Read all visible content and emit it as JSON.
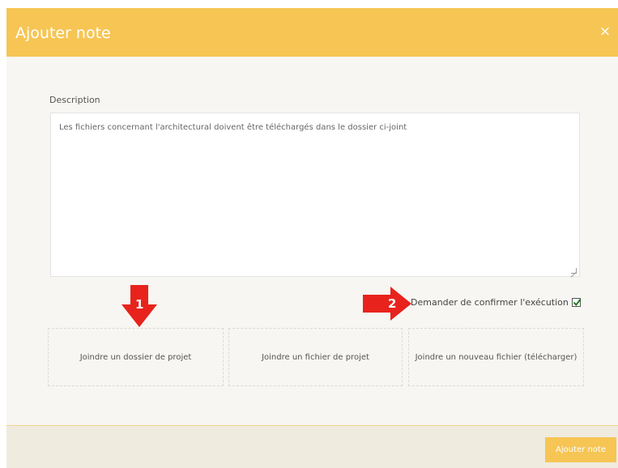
{
  "dialog": {
    "title": "Ajouter note",
    "close_glyph": "×"
  },
  "description": {
    "label": "Description",
    "value": "Les fichiers concernant l'architectural doivent être téléchargés dans le dossier ci-joint"
  },
  "confirm": {
    "label": "Demander de confirmer l'exécution",
    "checked": true
  },
  "attachments": [
    {
      "label": "Joindre un dossier de projet"
    },
    {
      "label": "Joindre un fichier de projet"
    },
    {
      "label": "Joindre un nouveau fichier (télécharger)"
    }
  ],
  "footer": {
    "submit_label": "Ajouter note"
  },
  "callouts": [
    {
      "number": "1",
      "icon": "arrow-down-icon"
    },
    {
      "number": "2",
      "icon": "arrow-right-icon"
    }
  ],
  "colors": {
    "header": "#f6c554",
    "body": "#f7f6f2",
    "footer": "#efebdf",
    "callout": "#e8231d"
  }
}
